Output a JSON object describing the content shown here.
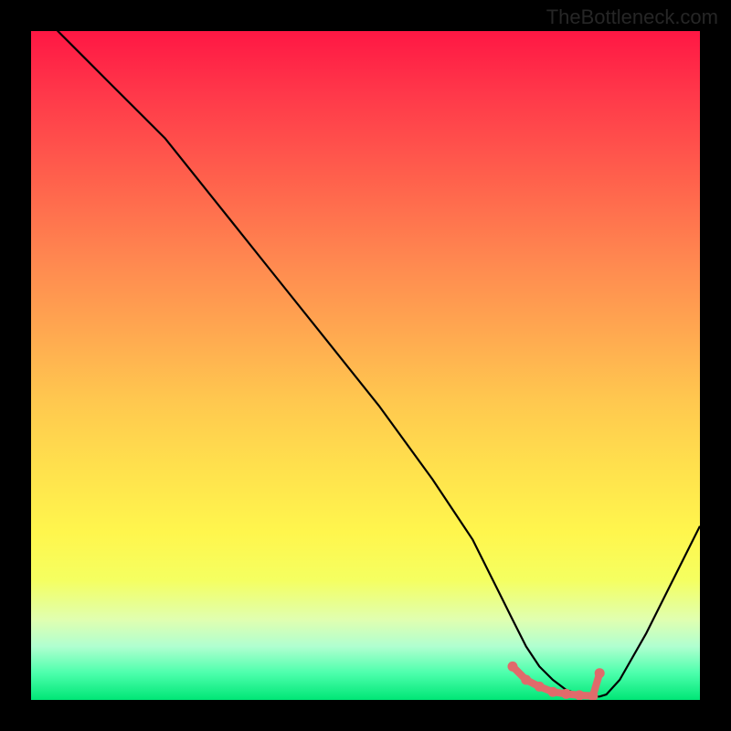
{
  "watermark": "TheBottleneck.com",
  "chart_data": {
    "type": "line",
    "title": "",
    "xlabel": "",
    "ylabel": "",
    "xlim": [
      0,
      100
    ],
    "ylim": [
      0,
      100
    ],
    "x": [
      0,
      4,
      8,
      12,
      20,
      28,
      36,
      44,
      52,
      60,
      66,
      70,
      72,
      74,
      76,
      78,
      80,
      82,
      84,
      85,
      86,
      88,
      92,
      96,
      100
    ],
    "values": [
      106,
      100,
      96,
      92,
      84,
      74,
      64,
      54,
      44,
      33,
      24,
      16,
      12,
      8,
      5,
      3,
      1.5,
      0.8,
      0.5,
      0.5,
      0.8,
      3,
      10,
      18,
      26
    ],
    "marker_points": {
      "x": [
        72,
        74,
        76,
        78,
        80,
        82,
        84,
        85
      ],
      "values": [
        5,
        3,
        2,
        1.2,
        0.9,
        0.7,
        0.6,
        4
      ]
    },
    "gradient_colors": {
      "top": "#ff1744",
      "mid": "#ffe04d",
      "bottom": "#00e676"
    }
  }
}
